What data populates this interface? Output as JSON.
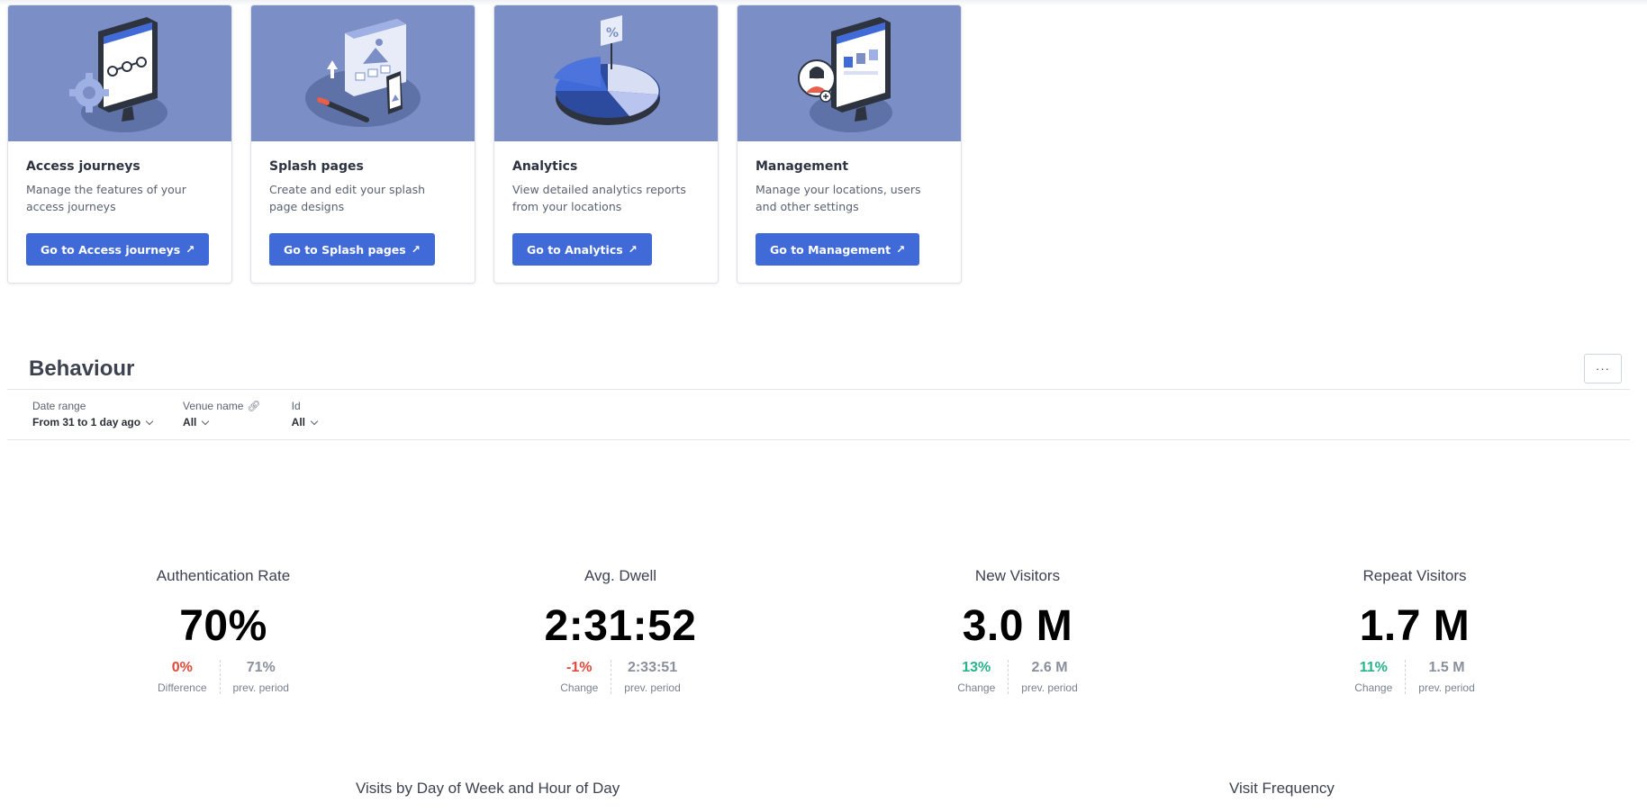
{
  "cards": [
    {
      "title": "Access journeys",
      "desc": "Manage the features of your access journeys",
      "button": "Go to Access journeys",
      "icon": "journey-monitor-illustration"
    },
    {
      "title": "Splash pages",
      "desc": "Create and edit your splash page designs",
      "button": "Go to Splash pages",
      "icon": "splash-design-illustration"
    },
    {
      "title": "Analytics",
      "desc": "View detailed analytics reports from your locations",
      "button": "Go to Analytics",
      "icon": "pie-chart-illustration"
    },
    {
      "title": "Management",
      "desc": "Manage your locations, users and other settings",
      "button": "Go to Management",
      "icon": "management-monitor-illustration"
    }
  ],
  "behaviour": {
    "title": "Behaviour",
    "menu": "···",
    "filters": [
      {
        "label": "Date range",
        "value": "From 31 to 1 day ago"
      },
      {
        "label": "Venue name",
        "value": "All"
      },
      {
        "label": "Id",
        "value": "All"
      }
    ]
  },
  "kpis": [
    {
      "title": "Authentication Rate",
      "value": "70%",
      "change": "0%",
      "change_label": "Difference",
      "prev": "71%",
      "prev_label": "prev. period",
      "trend": "neg"
    },
    {
      "title": "Avg. Dwell",
      "value": "2:31:52",
      "change": "-1%",
      "change_label": "Change",
      "prev": "2:33:51",
      "prev_label": "prev. period",
      "trend": "neg"
    },
    {
      "title": "New Visitors",
      "value": "3.0 M",
      "change": "13%",
      "change_label": "Change",
      "prev": "2.6 M",
      "prev_label": "prev. period",
      "trend": "pos"
    },
    {
      "title": "Repeat Visitors",
      "value": "1.7 M",
      "change": "11%",
      "change_label": "Change",
      "prev": "1.5 M",
      "prev_label": "prev. period",
      "trend": "pos"
    }
  ],
  "sections": {
    "visits_by_day": "Visits by Day of Week and Hour of Day",
    "visit_frequency": "Visit Frequency"
  },
  "colors": {
    "accent": "#3f6ad8",
    "hero": "#7b8fc6",
    "negative": "#e0493a",
    "positive": "#27b38b"
  }
}
